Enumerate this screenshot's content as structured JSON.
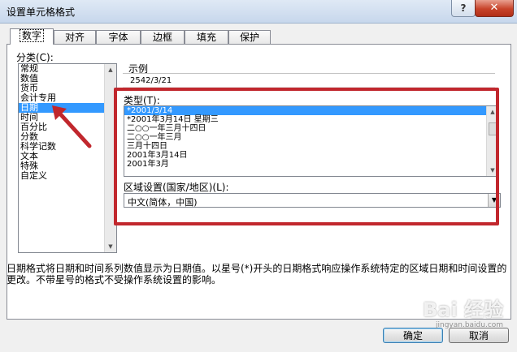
{
  "window": {
    "title": "设置单元格格式",
    "help_label": "?",
    "close_label": "✕"
  },
  "tabs": [
    {
      "label": "数字"
    },
    {
      "label": "对齐"
    },
    {
      "label": "字体"
    },
    {
      "label": "边框"
    },
    {
      "label": "填充"
    },
    {
      "label": "保护"
    }
  ],
  "category": {
    "label": "分类(C):",
    "items": [
      "常规",
      "数值",
      "货币",
      "会计专用",
      "日期",
      "时间",
      "百分比",
      "分数",
      "科学记数",
      "文本",
      "特殊",
      "自定义"
    ],
    "selected": "日期"
  },
  "sample": {
    "label": "示例",
    "value": "2542/3/21"
  },
  "type": {
    "label": "类型(T):",
    "items": [
      "*2001/3/14",
      "*2001年3月14日 星期三",
      "二○○一年三月十四日",
      "二○○一年三月",
      "三月十四日",
      "2001年3月14日",
      "2001年3月"
    ],
    "selected": "*2001/3/14"
  },
  "region": {
    "label": "区域设置(国家/地区)(L):",
    "value": "中文(简体，中国)"
  },
  "description": "日期格式将日期和时间系列数值显示为日期值。以星号(*)开头的日期格式响应操作系统特定的区域日期和时间设置的更改。不带星号的格式不受操作系统设置的影响。",
  "buttons": {
    "ok": "确定",
    "cancel": "取消"
  },
  "watermark": {
    "text": "Bai 经验",
    "sub": "jingyan.baidu.com"
  },
  "colors": {
    "highlight": "#3399ff",
    "annotation_red": "#c1272d"
  }
}
